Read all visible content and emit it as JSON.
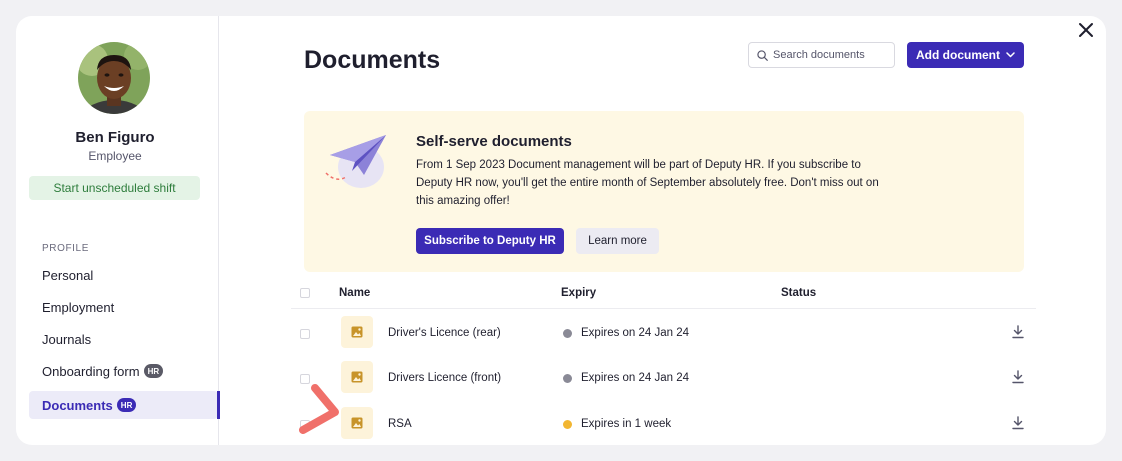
{
  "user": {
    "name": "Ben Figuro",
    "role": "Employee"
  },
  "sidebar": {
    "shift_button": "Start unscheduled shift",
    "section_label": "PROFILE",
    "items": [
      {
        "label": "Personal",
        "badge": ""
      },
      {
        "label": "Employment",
        "badge": ""
      },
      {
        "label": "Journals",
        "badge": ""
      },
      {
        "label": "Onboarding form",
        "badge": "HR"
      },
      {
        "label": "Documents",
        "badge": "HR"
      }
    ]
  },
  "main": {
    "title": "Documents",
    "search_placeholder": "Search documents",
    "add_button": "Add document"
  },
  "banner": {
    "title": "Self-serve documents",
    "text": "From 1 Sep 2023 Document management will be part of Deputy HR. If you subscribe to Deputy HR now, you'll get the entire month of September absolutely free. Don't miss out on this amazing offer!",
    "subscribe_button": "Subscribe to Deputy HR",
    "learn_button": "Learn more"
  },
  "table": {
    "headers": {
      "name": "Name",
      "expiry": "Expiry",
      "status": "Status"
    },
    "rows": [
      {
        "name": "Driver's Licence (rear)",
        "expiry": "Expires on 24 Jan 24",
        "expiry_color": "#8a8a96"
      },
      {
        "name": "Drivers Licence (front)",
        "expiry": "Expires on 24 Jan 24",
        "expiry_color": "#8a8a96"
      },
      {
        "name": "RSA",
        "expiry": "Expires in 1 week",
        "expiry_color": "#f2b632"
      }
    ]
  },
  "colors": {
    "accent": "#3b2bb5",
    "banner_bg": "#fef8e4",
    "annotation": "#f0706a"
  }
}
